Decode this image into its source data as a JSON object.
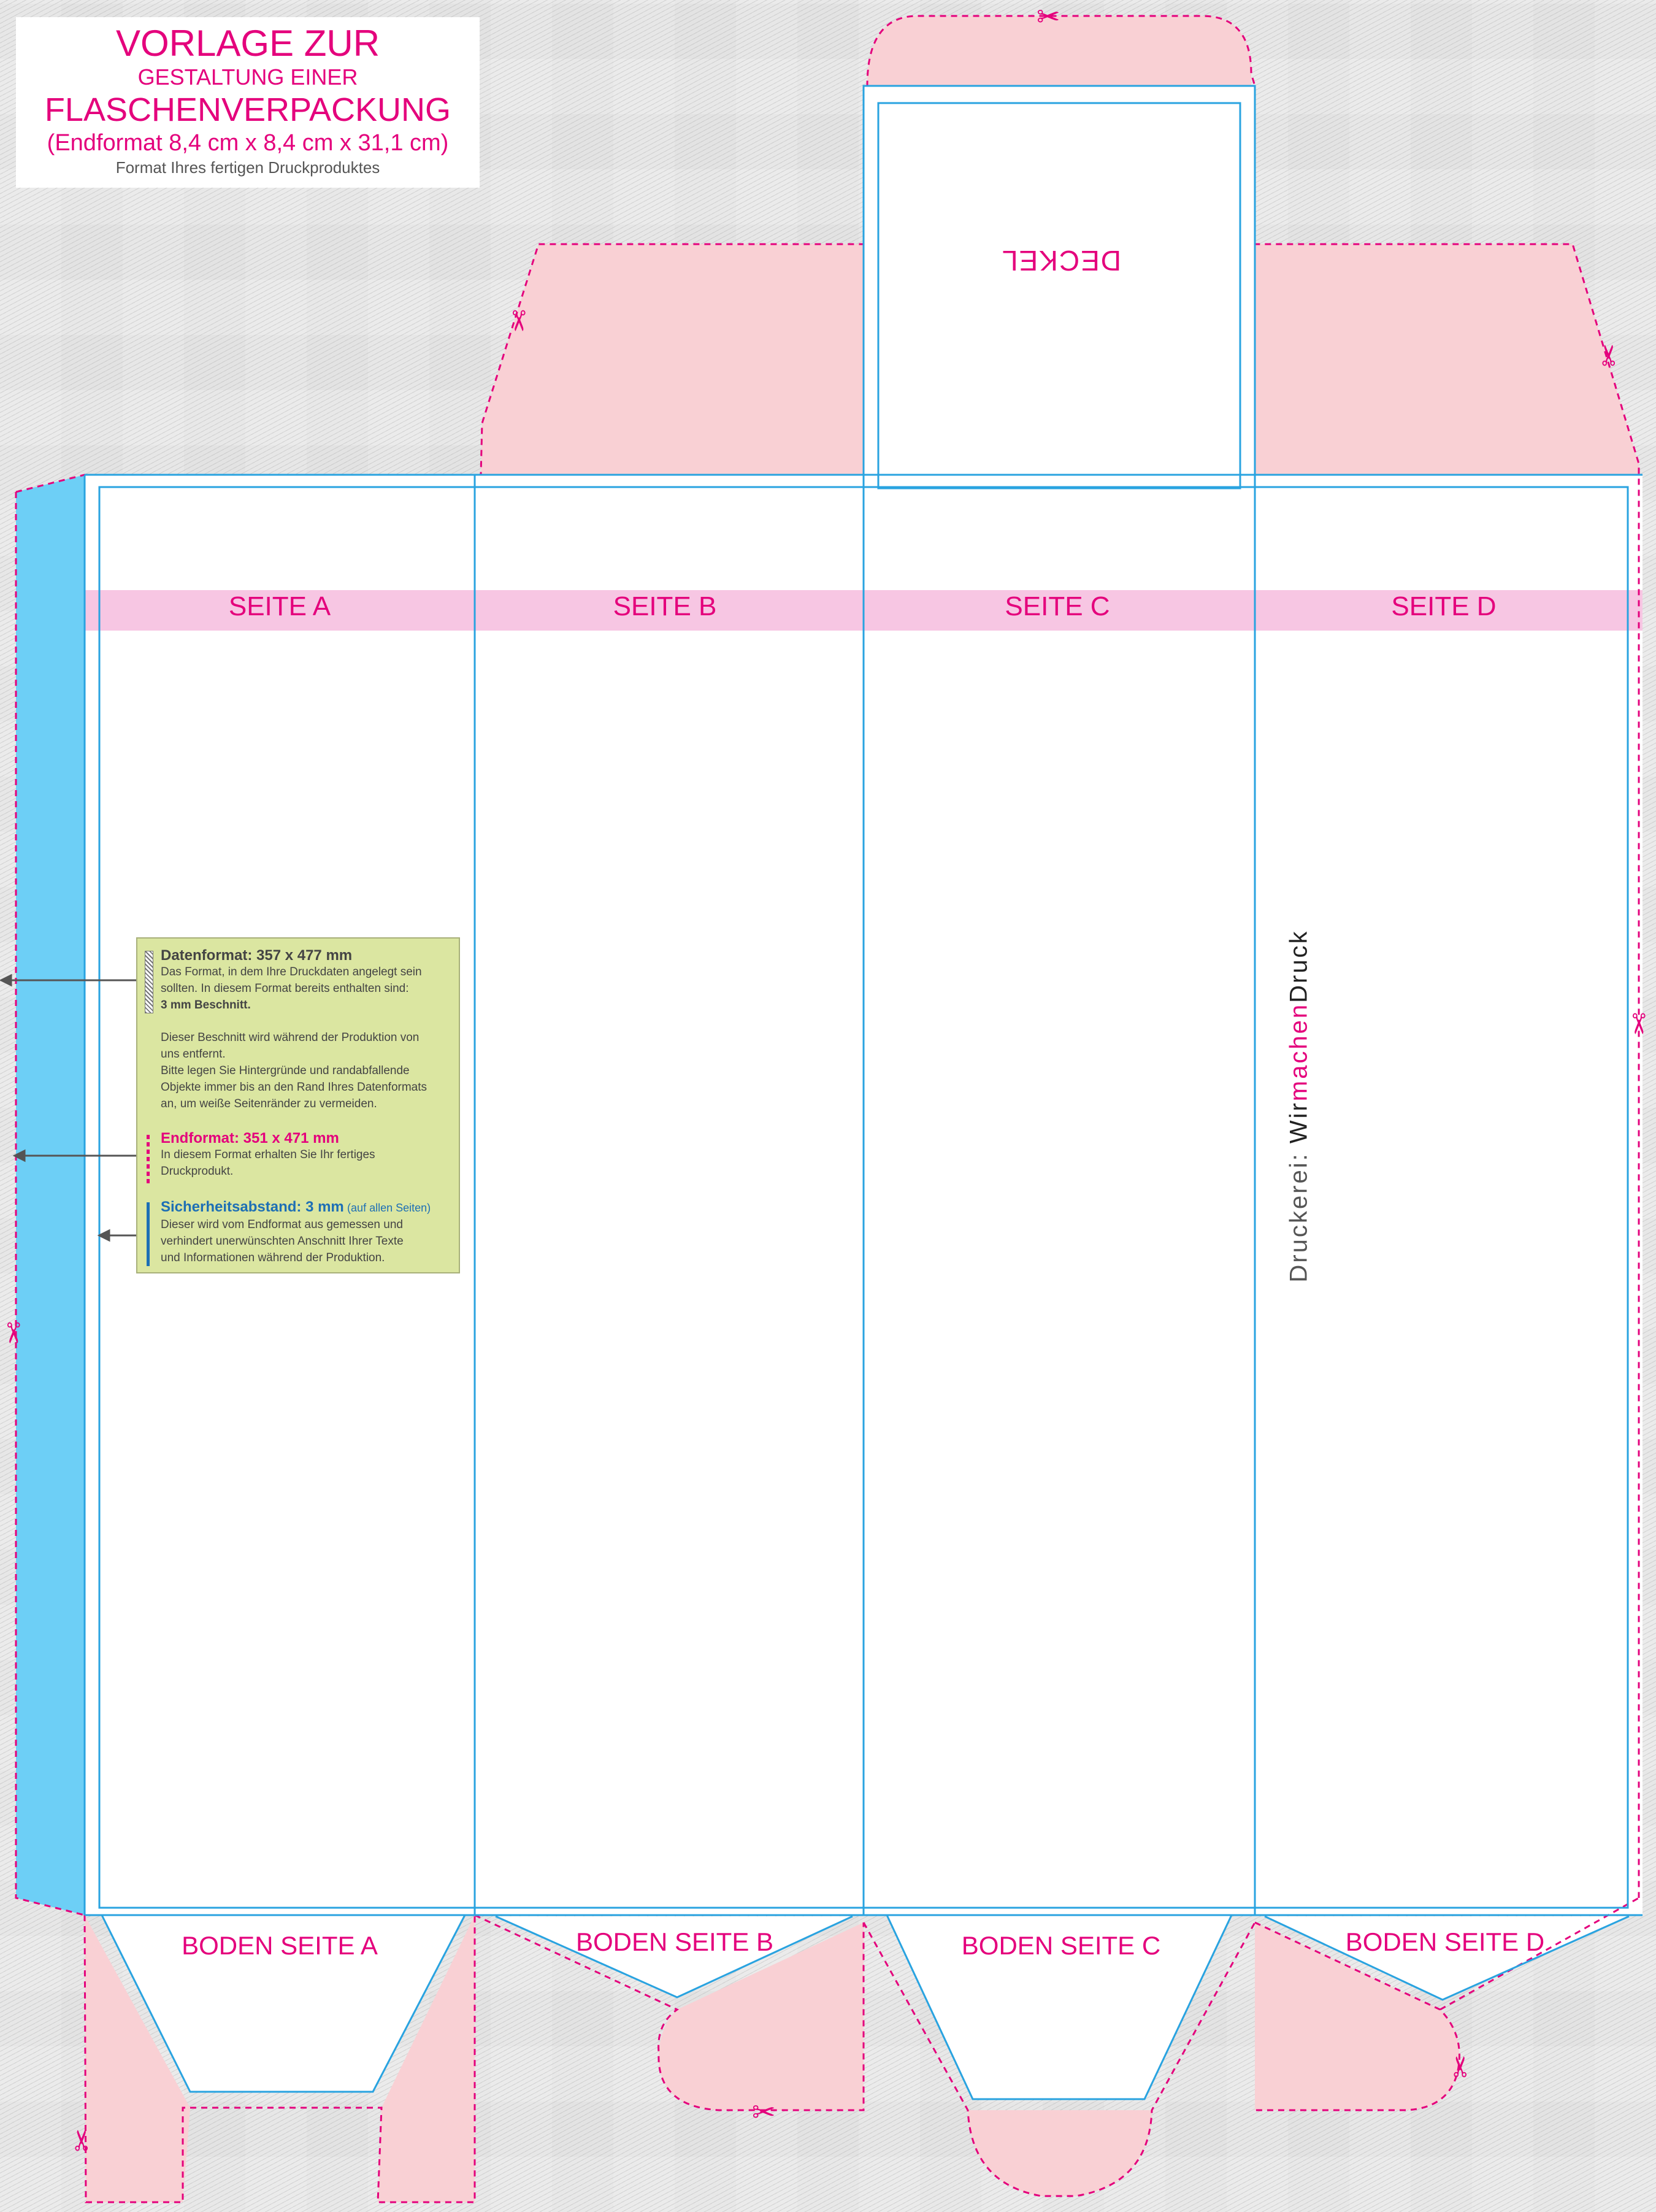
{
  "title": {
    "line1": "VORLAGE ZUR",
    "line2": "GESTALTUNG EINER",
    "line3": "FLASCHENVERPACKUNG",
    "line4": "(Endformat 8,4 cm x 8,4 cm x 31,1 cm)",
    "line5": "Format Ihres fertigen Druckproduktes"
  },
  "panels": {
    "lid": "DECKEL",
    "sides": [
      "SEITE A",
      "SEITE B",
      "SEITE C",
      "SEITE D"
    ],
    "bottoms": [
      "BODEN SEITE A",
      "BODEN SEITE B",
      "BODEN SEITE C",
      "BODEN SEITE D"
    ]
  },
  "info": {
    "datenformat": {
      "heading": "Datenformat: 357 x 477 mm",
      "lines": [
        "Das Format, in dem Ihre Druckdaten angelegt sein",
        "sollten. In diesem Format bereits enthalten sind:"
      ],
      "bold": "3 mm Beschnitt.",
      "para": [
        "Dieser Beschnitt wird während der Produktion von",
        "uns entfernt.",
        "Bitte legen Sie Hintergründe und randabfallende",
        "Objekte immer bis an den Rand Ihres Datenformats",
        "an, um weiße Seitenränder zu vermeiden."
      ]
    },
    "endformat": {
      "heading": "Endformat: 351 x 471 mm",
      "lines": [
        "In diesem Format erhalten Sie Ihr fertiges",
        "Druckprodukt."
      ]
    },
    "sicherheit": {
      "heading": "Sicherheitsabstand: 3 mm",
      "note": "(auf allen Seiten)",
      "lines": [
        "Dieser wird vom Endformat aus gemessen und",
        "verhindert unerwünschten Anschnitt Ihrer Texte",
        "und Informationen während der Produktion."
      ]
    }
  },
  "brand": {
    "prefix": "Druckerei: ",
    "part1": "Wir",
    "part2": "machen",
    "part3": "Druck"
  },
  "icons": {
    "cut_marker": "scissors-icon",
    "pointer": "arrow-left-icon"
  },
  "colors": {
    "magenta": "#e4007c",
    "blue_line": "#29a3e0",
    "glue_flap": "#6dcff6",
    "flap_pink": "#f9d0d4",
    "band_pink": "#f7c6e3",
    "info_box": "#dbe6a1"
  }
}
